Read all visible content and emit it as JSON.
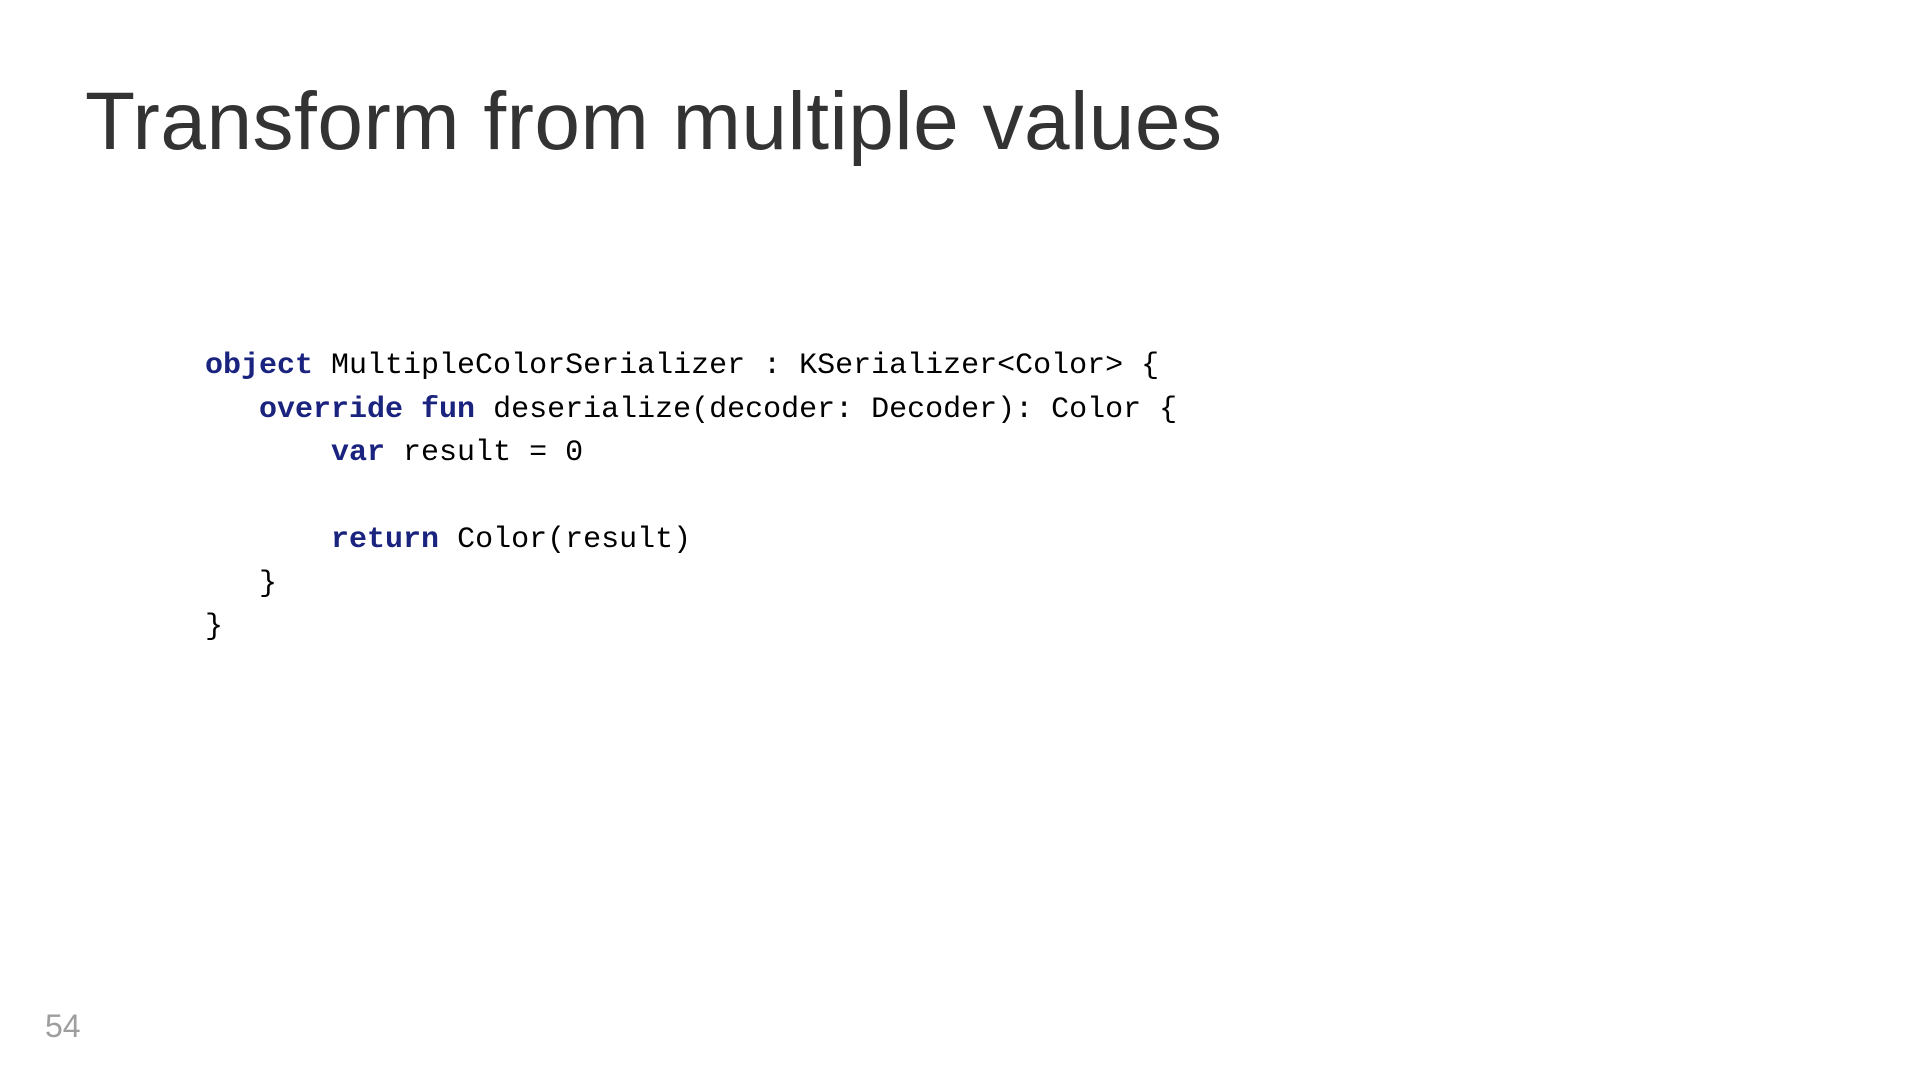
{
  "title": "Transform from multiple values",
  "pageNumber": "54",
  "code": {
    "kw_object": "object",
    "decl_rest": " MultipleColorSerializer : KSerializer<Color> {",
    "kw_override_fun": "override fun",
    "fun_rest": " deserialize(decoder: Decoder): Color {",
    "kw_var": "var",
    "var_rest": " result = 0",
    "kw_return": "return",
    "return_rest": " Color(result)",
    "close_inner": "   }",
    "close_outer": "}"
  }
}
